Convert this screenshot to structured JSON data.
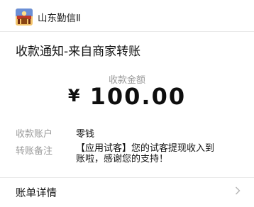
{
  "header": {
    "sender_name": "山东勤信Ⅱ",
    "avatar_icon": "game-app-logo-icon"
  },
  "message": {
    "title": "收款通知-来自商家转账"
  },
  "amount": {
    "label": "收款金额",
    "currency": "¥",
    "value": "100.00"
  },
  "details": {
    "account_label": "收款账户",
    "account_value": "零钱",
    "remark_label": "转账备注",
    "remark_line1": "【应用试客】您的试客提现收入到",
    "remark_line2": "账啦，感谢您的支持！"
  },
  "footer": {
    "detail_label": "账单详情",
    "chevron_icon": "chevron-right-icon"
  },
  "colors": {
    "text_primary": "#111111",
    "text_secondary": "#9a9a9a",
    "divider": "#e9e9e9"
  }
}
